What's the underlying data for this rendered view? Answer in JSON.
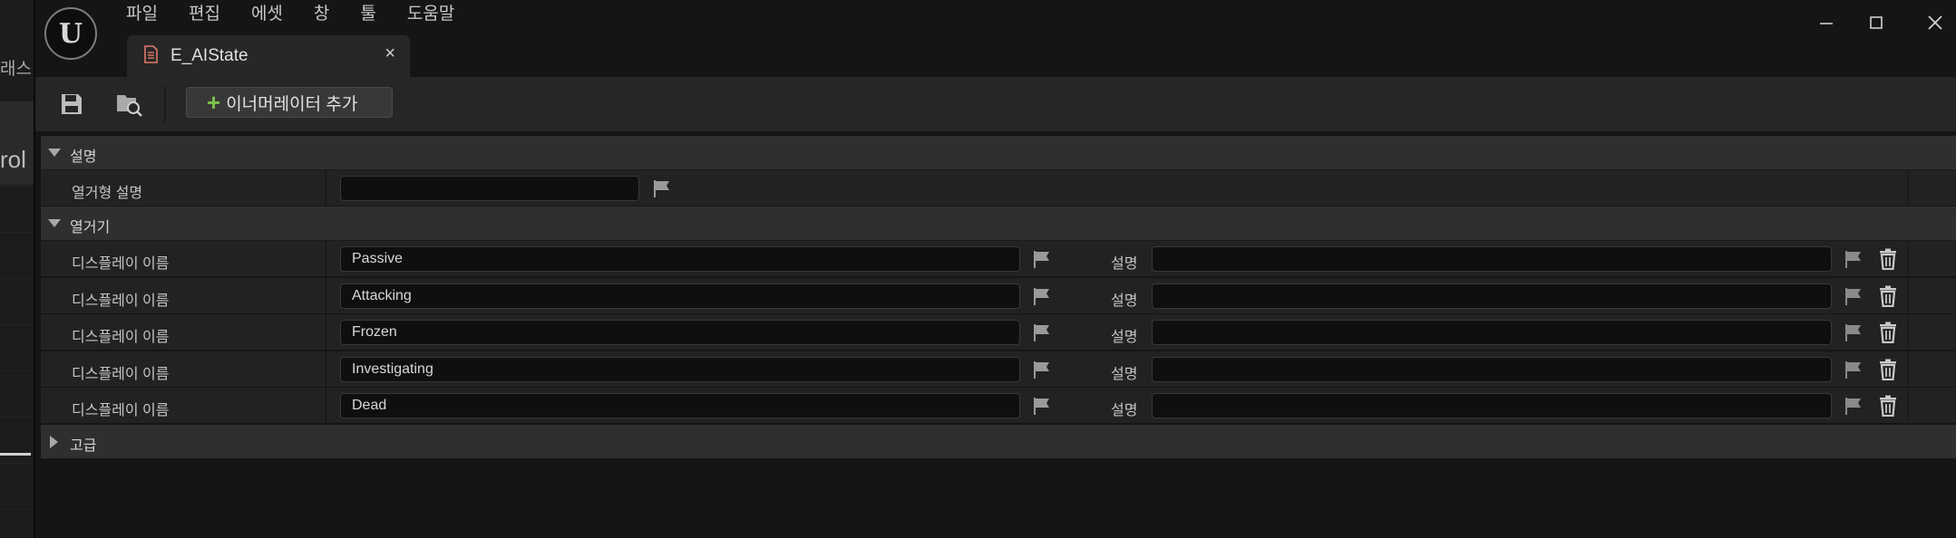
{
  "background": {
    "sliver_text_top": "래스",
    "sliver_text_mid": "rol"
  },
  "menu": [
    "파일",
    "편집",
    "에셋",
    "창",
    "툴",
    "도움말"
  ],
  "tab": {
    "title": "E_AIState",
    "close_glyph": "×"
  },
  "toolbar": {
    "add_enumerator_label": "이너머레이터 추가"
  },
  "sections": {
    "description": {
      "label": "설명",
      "row_label": "열거형 설명",
      "value": ""
    },
    "enumerators": {
      "label": "열거기",
      "rows": [
        {
          "name_label": "디스플레이 이름",
          "display_name": "Passive",
          "desc_label": "설명",
          "description": ""
        },
        {
          "name_label": "디스플레이 이름",
          "display_name": "Attacking",
          "desc_label": "설명",
          "description": ""
        },
        {
          "name_label": "디스플레이 이름",
          "display_name": "Frozen",
          "desc_label": "설명",
          "description": ""
        },
        {
          "name_label": "디스플레이 이름",
          "display_name": "Investigating",
          "desc_label": "설명",
          "description": ""
        },
        {
          "name_label": "디스플레이 이름",
          "display_name": "Dead",
          "desc_label": "설명",
          "description": ""
        }
      ]
    },
    "advanced": {
      "label": "고급"
    }
  },
  "colors": {
    "accent_blue": "#1f6bd9",
    "add_green": "#7fc24a",
    "panel_bg": "#151515",
    "header_bg": "#2f2f2f"
  },
  "icons": {
    "logo": "unreal-logo-icon",
    "save": "save-icon",
    "browse": "browse-asset-icon",
    "flag": "flag-icon",
    "trash": "trash-icon",
    "minimize": "minimize-icon",
    "maximize": "maximize-icon",
    "close": "close-icon"
  }
}
